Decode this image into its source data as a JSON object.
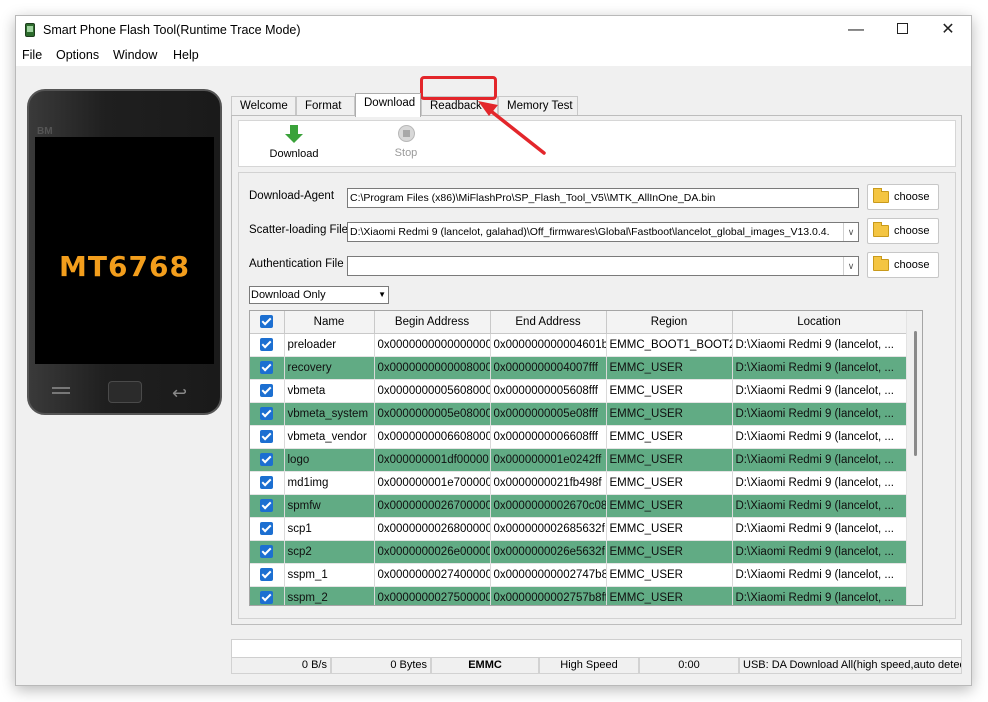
{
  "window": {
    "title": "Smart Phone Flash Tool(Runtime Trace Mode)"
  },
  "titlebar_buttons": {
    "minimize": "—",
    "close": "✕"
  },
  "menu": [
    "File",
    "Options",
    "Window",
    "Help"
  ],
  "phone": {
    "brand_mark": "BM",
    "chip": "MT6768"
  },
  "tabs": [
    "Welcome",
    "Format",
    "Download",
    "Readback",
    "Memory Test"
  ],
  "active_tab": "Download",
  "toolbar": {
    "download_label": "Download",
    "stop_label": "Stop"
  },
  "fields": {
    "download_agent": {
      "label": "Download-Agent",
      "value": "C:\\Program Files (x86)\\MiFlashPro\\SP_Flash_Tool_V5\\\\MTK_AllInOne_DA.bin",
      "button": "choose"
    },
    "scatter": {
      "label": "Scatter-loading File",
      "value": "D:\\Xiaomi Redmi 9 (lancelot, galahad)\\Off_firmwares\\Global\\Fastboot\\lancelot_global_images_V13.0.4.",
      "button": "choose"
    },
    "auth": {
      "label": "Authentication File",
      "value": "",
      "button": "choose"
    }
  },
  "mode": {
    "selected": "Download Only"
  },
  "table": {
    "headers": [
      "Name",
      "Begin Address",
      "End Address",
      "Region",
      "Location"
    ],
    "rows": [
      [
        "preloader",
        "0x0000000000000000",
        "0x000000000004601b",
        "EMMC_BOOT1_BOOT2",
        "D:\\Xiaomi Redmi 9 (lancelot, ..."
      ],
      [
        "recovery",
        "0x0000000000008000",
        "0x0000000004007fff",
        "EMMC_USER",
        "D:\\Xiaomi Redmi 9 (lancelot, ..."
      ],
      [
        "vbmeta",
        "0x0000000005608000",
        "0x0000000005608fff",
        "EMMC_USER",
        "D:\\Xiaomi Redmi 9 (lancelot, ..."
      ],
      [
        "vbmeta_system",
        "0x0000000005e08000",
        "0x0000000005e08fff",
        "EMMC_USER",
        "D:\\Xiaomi Redmi 9 (lancelot, ..."
      ],
      [
        "vbmeta_vendor",
        "0x0000000006608000",
        "0x0000000006608fff",
        "EMMC_USER",
        "D:\\Xiaomi Redmi 9 (lancelot, ..."
      ],
      [
        "logo",
        "0x000000001df00000",
        "0x000000001e0242ff",
        "EMMC_USER",
        "D:\\Xiaomi Redmi 9 (lancelot, ..."
      ],
      [
        "md1img",
        "0x000000001e700000",
        "0x0000000021fb498f",
        "EMMC_USER",
        "D:\\Xiaomi Redmi 9 (lancelot, ..."
      ],
      [
        "spmfw",
        "0x0000000026700000",
        "0x0000000002670c08f",
        "EMMC_USER",
        "D:\\Xiaomi Redmi 9 (lancelot, ..."
      ],
      [
        "scp1",
        "0x0000000026800000",
        "0x000000002685632f",
        "EMMC_USER",
        "D:\\Xiaomi Redmi 9 (lancelot, ..."
      ],
      [
        "scp2",
        "0x0000000026e00000",
        "0x0000000026e5632f",
        "EMMC_USER",
        "D:\\Xiaomi Redmi 9 (lancelot, ..."
      ],
      [
        "sspm_1",
        "0x0000000027400000",
        "0x00000000002747b8ff",
        "EMMC_USER",
        "D:\\Xiaomi Redmi 9 (lancelot, ..."
      ],
      [
        "sspm_2",
        "0x0000000027500000",
        "0x0000000002757b8ff",
        "EMMC_USER",
        "D:\\Xiaomi Redmi 9 (lancelot, ..."
      ]
    ]
  },
  "status": {
    "speed": "0 B/s",
    "bytes": "0 Bytes",
    "storage": "EMMC",
    "mode": "High Speed",
    "time": "0:00",
    "usb": "USB: DA Download All(high speed,auto detect)"
  },
  "colors": {
    "row_highlight": "#61ab84",
    "checkbox": "#1c6fd1",
    "annotation": "#e3262b",
    "chip_text": "#f39e1c"
  },
  "icons": [
    "app-icon",
    "download-arrow-icon",
    "stop-icon",
    "folder-icon",
    "checkbox-checked-icon",
    "phone-menu-icon",
    "phone-back-icon",
    "annotation-arrow-icon"
  ]
}
